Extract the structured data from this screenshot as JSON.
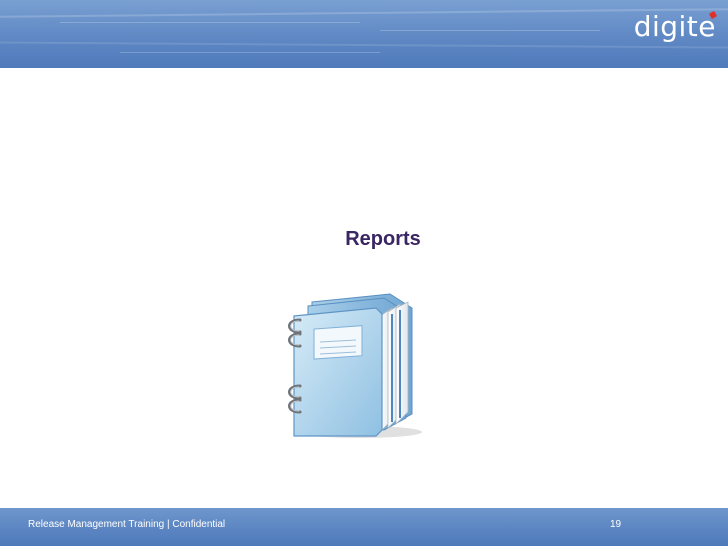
{
  "header": {
    "logo_text": "digite",
    "colors": {
      "band": "#5f88c4",
      "logo_accent": "#e0302a"
    }
  },
  "slide": {
    "title": "Reports",
    "title_color": "#3a2662",
    "illustration_icon": "notebook-stack-icon"
  },
  "footer": {
    "text": "Release Management Training |  Confidential",
    "page_number": "19"
  }
}
